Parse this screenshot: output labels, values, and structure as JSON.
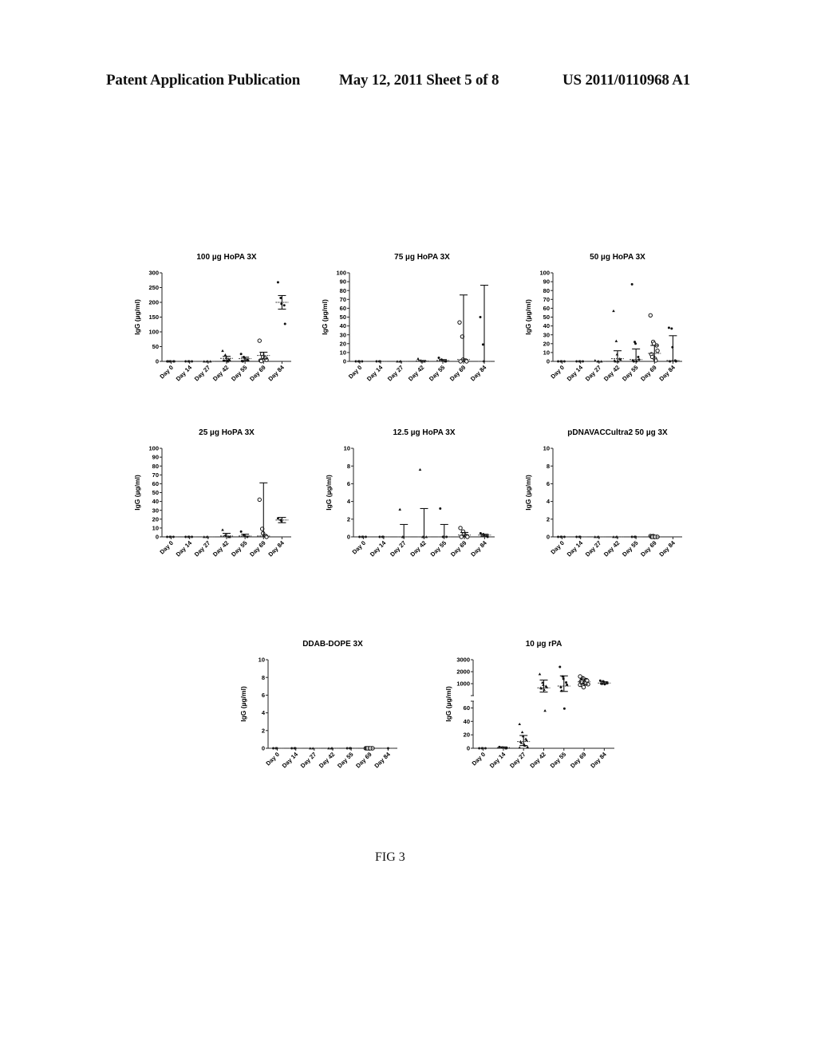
{
  "header": {
    "left": "Patent Application Publication",
    "middle": "May 12, 2011   Sheet 5 of 8",
    "right": "US 2011/0110968 A1"
  },
  "figure_caption": "FIG 3",
  "chart_data": [
    {
      "id": "c100",
      "type": "scatter",
      "title": "100 µg HoPA 3X",
      "xlabel": "",
      "ylabel": "IgG (µg/ml)",
      "categories": [
        "Day 0",
        "Day 14",
        "Day 27",
        "Day 42",
        "Day 55",
        "Day 69",
        "Day 84"
      ],
      "ylim": [
        0,
        300
      ],
      "yticks": [
        0,
        50,
        100,
        150,
        200,
        250,
        300
      ],
      "series": [
        {
          "name": "Day 0",
          "points": [
            0,
            0,
            0,
            0,
            0,
            0
          ],
          "mean": 0,
          "err": [
            0,
            0
          ]
        },
        {
          "name": "Day 14",
          "points": [
            0,
            0,
            0,
            0
          ],
          "mean": 0,
          "err": [
            0,
            0
          ]
        },
        {
          "name": "Day 27",
          "points": [
            0,
            0,
            0,
            0
          ],
          "mean": 0,
          "err": [
            0,
            0
          ]
        },
        {
          "name": "Day 42",
          "points": [
            36,
            22,
            12,
            8,
            5,
            3,
            2,
            1,
            0
          ],
          "mean": 10,
          "err": [
            4,
            17
          ]
        },
        {
          "name": "Day 55",
          "points": [
            25,
            15,
            10,
            6,
            3,
            1,
            0
          ],
          "mean": 9,
          "err": [
            3,
            14
          ]
        },
        {
          "name": "Day 69",
          "points": [
            70,
            25,
            15,
            10,
            5,
            3,
            1
          ],
          "mean": 20,
          "err": [
            8,
            31
          ]
        },
        {
          "name": "Day 84",
          "points": [
            268,
            215,
            195,
            190,
            127
          ],
          "mean": 200,
          "err": [
            177,
            223
          ]
        }
      ]
    },
    {
      "id": "c75",
      "type": "scatter",
      "title": "75 µg HoPA 3X",
      "xlabel": "",
      "ylabel": "IgG (µg/ml)",
      "categories": [
        "Day 0",
        "Day 14",
        "Day 27",
        "Day 42",
        "Day 55",
        "Day 69",
        "Day 84"
      ],
      "ylim": [
        0,
        100
      ],
      "yticks": [
        0,
        10,
        20,
        30,
        40,
        50,
        60,
        70,
        80,
        90,
        100
      ],
      "series": [
        {
          "name": "Day 0",
          "points": [
            0,
            0,
            0,
            0
          ],
          "mean": 0,
          "err": [
            0,
            0
          ]
        },
        {
          "name": "Day 14",
          "points": [
            0,
            0,
            0
          ],
          "mean": 0,
          "err": [
            0,
            0
          ]
        },
        {
          "name": "Day 27",
          "points": [
            0,
            0,
            0
          ],
          "mean": 0,
          "err": [
            0,
            0
          ]
        },
        {
          "name": "Day 42",
          "points": [
            3,
            1,
            0,
            0
          ],
          "mean": 0.5,
          "err": [
            0,
            1
          ]
        },
        {
          "name": "Day 55",
          "points": [
            4,
            2,
            1,
            0,
            0
          ],
          "mean": 1,
          "err": [
            0,
            2
          ]
        },
        {
          "name": "Day 69",
          "points": [
            44,
            28,
            2,
            1,
            0,
            0
          ],
          "mean": 2,
          "err": [
            0,
            75
          ]
        },
        {
          "name": "Day 84",
          "points": [
            50,
            19,
            0
          ],
          "mean": 0,
          "err": [
            0,
            86
          ]
        }
      ]
    },
    {
      "id": "c50",
      "type": "scatter",
      "title": "50 µg HoPA 3X",
      "xlabel": "",
      "ylabel": "IgG (µg/ml)",
      "categories": [
        "Day 0",
        "Day 14",
        "Day 27",
        "Day 42",
        "Day 55",
        "Day 69",
        "Day 84"
      ],
      "ylim": [
        0,
        100
      ],
      "yticks": [
        0,
        10,
        20,
        30,
        40,
        50,
        60,
        70,
        80,
        90,
        100
      ],
      "series": [
        {
          "name": "Day 0",
          "points": [
            0,
            0,
            0,
            0
          ],
          "mean": 0,
          "err": [
            0,
            0
          ]
        },
        {
          "name": "Day 14",
          "points": [
            0,
            0,
            0,
            0
          ],
          "mean": 0,
          "err": [
            0,
            0
          ]
        },
        {
          "name": "Day 27",
          "points": [
            1,
            0,
            0,
            0
          ],
          "mean": 0,
          "err": [
            0,
            0
          ]
        },
        {
          "name": "Day 42",
          "points": [
            57,
            23,
            8,
            3,
            2,
            1,
            0,
            0
          ],
          "mean": 3,
          "err": [
            0,
            12
          ]
        },
        {
          "name": "Day 55",
          "points": [
            87,
            22,
            20,
            5,
            2,
            1,
            0,
            0
          ],
          "mean": 2,
          "err": [
            0,
            14
          ]
        },
        {
          "name": "Day 69",
          "points": [
            52,
            22,
            20,
            18,
            12,
            8,
            5,
            3,
            1
          ],
          "mean": 9,
          "err": [
            0,
            18
          ]
        },
        {
          "name": "Day 84",
          "points": [
            38,
            37,
            16,
            1,
            0,
            0
          ],
          "mean": 1,
          "err": [
            0,
            29
          ]
        }
      ]
    },
    {
      "id": "c25",
      "type": "scatter",
      "title": "25 µg HoPA 3X",
      "xlabel": "",
      "ylabel": "IgG (µg/ml)",
      "categories": [
        "Day 0",
        "Day 14",
        "Day 27",
        "Day 42",
        "Day 55",
        "Day 69",
        "Day 84"
      ],
      "ylim": [
        0,
        100
      ],
      "yticks": [
        0,
        10,
        20,
        30,
        40,
        50,
        60,
        70,
        80,
        90,
        100
      ],
      "series": [
        {
          "name": "Day 0",
          "points": [
            0,
            0,
            0,
            0
          ],
          "mean": 0,
          "err": [
            0,
            0
          ]
        },
        {
          "name": "Day 14",
          "points": [
            0,
            0,
            0,
            0
          ],
          "mean": 0,
          "err": [
            0,
            0
          ]
        },
        {
          "name": "Day 27",
          "points": [
            0,
            0,
            0
          ],
          "mean": 0,
          "err": [
            0,
            0
          ]
        },
        {
          "name": "Day 42",
          "points": [
            8,
            2,
            1,
            0,
            0
          ],
          "mean": 1,
          "err": [
            0,
            4
          ]
        },
        {
          "name": "Day 55",
          "points": [
            6,
            2,
            1,
            0
          ],
          "mean": 1,
          "err": [
            0,
            3
          ]
        },
        {
          "name": "Day 69",
          "points": [
            42,
            9,
            4,
            1,
            0
          ],
          "mean": 1,
          "err": [
            0,
            61
          ]
        },
        {
          "name": "Day 84",
          "points": [
            21,
            19,
            18
          ],
          "mean": 19,
          "err": [
            16,
            22
          ]
        }
      ]
    },
    {
      "id": "c125",
      "type": "scatter",
      "title": "12.5 µg HoPA 3X",
      "xlabel": "",
      "ylabel": "IgG (µg/ml)",
      "categories": [
        "Day 0",
        "Day 14",
        "Day 27",
        "Day 42",
        "Day 55",
        "Day 69",
        "Day 84"
      ],
      "ylim": [
        0,
        10
      ],
      "yticks": [
        0,
        2,
        4,
        6,
        8,
        10
      ],
      "series": [
        {
          "name": "Day 0",
          "points": [
            0,
            0,
            0,
            0
          ],
          "mean": 0,
          "err": [
            0,
            0
          ]
        },
        {
          "name": "Day 14",
          "points": [
            0,
            0,
            0
          ],
          "mean": 0,
          "err": [
            0,
            0
          ]
        },
        {
          "name": "Day 27",
          "points": [
            3.1,
            0,
            0
          ],
          "mean": 0,
          "err": [
            0,
            1.4
          ]
        },
        {
          "name": "Day 42",
          "points": [
            7.6,
            0,
            0,
            0
          ],
          "mean": 0,
          "err": [
            0,
            3.2
          ]
        },
        {
          "name": "Day 55",
          "points": [
            3.2,
            0,
            0,
            0
          ],
          "mean": 0,
          "err": [
            0,
            1.4
          ]
        },
        {
          "name": "Day 69",
          "points": [
            1.0,
            0.6,
            0.3,
            0.1,
            0,
            0
          ],
          "mean": 0.2,
          "err": [
            0,
            0.5
          ]
        },
        {
          "name": "Day 84",
          "points": [
            0.4,
            0.3,
            0.2,
            0.1,
            0
          ],
          "mean": 0.2,
          "err": [
            0.1,
            0.3
          ]
        }
      ]
    },
    {
      "id": "cpdna",
      "type": "scatter",
      "title": "pDNAVACCultra2 50 µg 3X",
      "xlabel": "",
      "ylabel": "IgG (µg/ml)",
      "categories": [
        "Day 0",
        "Day 14",
        "Day 27",
        "Day 42",
        "Day 55",
        "Day 69",
        "Day 84"
      ],
      "ylim": [
        0,
        10
      ],
      "yticks": [
        0,
        2,
        4,
        6,
        8,
        10
      ],
      "series": [
        {
          "name": "Day 0",
          "points": [
            0,
            0,
            0,
            0
          ],
          "mean": 0,
          "err": [
            0,
            0
          ]
        },
        {
          "name": "Day 14",
          "points": [
            0,
            0,
            0
          ],
          "mean": 0,
          "err": [
            0,
            0
          ]
        },
        {
          "name": "Day 27",
          "points": [
            0,
            0,
            0
          ],
          "mean": 0,
          "err": [
            0,
            0
          ]
        },
        {
          "name": "Day 42",
          "points": [
            0,
            0,
            0
          ],
          "mean": 0,
          "err": [
            0,
            0
          ]
        },
        {
          "name": "Day 55",
          "points": [
            0,
            0,
            0
          ],
          "mean": 0,
          "err": [
            0,
            0
          ]
        },
        {
          "name": "Day 69",
          "points": [
            0.1,
            0.1,
            0,
            0,
            0,
            0,
            0,
            0
          ],
          "mean": 0,
          "err": [
            0,
            0
          ]
        },
        {
          "name": "Day 84",
          "points": [],
          "mean": null,
          "err": [
            0,
            0
          ]
        }
      ]
    },
    {
      "id": "cddab",
      "type": "scatter",
      "title": "DDAB-DOPE 3X",
      "xlabel": "",
      "ylabel": "IgG (µg/ml)",
      "categories": [
        "Day 0",
        "Day 14",
        "Day 27",
        "Day 42",
        "Day 55",
        "Day 69",
        "Day 84"
      ],
      "ylim": [
        0,
        10
      ],
      "yticks": [
        0,
        2,
        4,
        6,
        8,
        10
      ],
      "series": [
        {
          "name": "Day 0",
          "points": [
            0,
            0,
            0
          ],
          "mean": 0,
          "err": [
            0,
            0
          ]
        },
        {
          "name": "Day 14",
          "points": [
            0,
            0,
            0
          ],
          "mean": 0,
          "err": [
            0,
            0
          ]
        },
        {
          "name": "Day 27",
          "points": [
            0,
            0
          ],
          "mean": 0,
          "err": [
            0,
            0
          ]
        },
        {
          "name": "Day 42",
          "points": [
            0,
            0,
            0
          ],
          "mean": 0,
          "err": [
            0,
            0
          ]
        },
        {
          "name": "Day 55",
          "points": [
            0,
            0,
            0
          ],
          "mean": 0,
          "err": [
            0,
            0
          ]
        },
        {
          "name": "Day 69",
          "points": [
            0,
            0,
            0,
            0,
            0,
            0,
            0,
            0
          ],
          "mean": 0,
          "err": [
            0,
            0
          ]
        },
        {
          "name": "Day 84",
          "points": [
            0
          ],
          "mean": 0,
          "err": [
            0,
            0
          ]
        }
      ]
    },
    {
      "id": "crpa",
      "type": "scatter",
      "title": "10 µg rPA",
      "xlabel": "",
      "ylabel": "IgG (µg/ml)",
      "categories": [
        "Day 0",
        "Day 14",
        "Day 27",
        "Day 42",
        "Day 55",
        "Day 69",
        "Day 84"
      ],
      "broken_axis": {
        "lower": [
          0,
          70
        ],
        "upper": [
          0,
          3000
        ]
      },
      "yticks_lower": [
        0,
        20,
        40,
        60
      ],
      "yticks_upper": [
        1000,
        2000,
        3000
      ],
      "series": [
        {
          "name": "Day 0",
          "points": [
            0,
            0,
            0,
            0
          ],
          "mean": 0,
          "err": [
            0,
            0
          ]
        },
        {
          "name": "Day 14",
          "points": [
            2,
            1,
            1,
            0,
            0
          ],
          "mean": 1,
          "err": [
            0,
            2
          ]
        },
        {
          "name": "Day 27",
          "points": [
            36,
            24,
            18,
            14,
            12,
            10,
            8,
            6,
            4,
            2,
            1
          ],
          "mean": 10,
          "err": [
            4,
            19
          ]
        },
        {
          "name": "Day 42",
          "points": [
            1800,
            1100,
            900,
            800,
            700,
            650,
            600,
            500,
            56
          ],
          "mean": 650,
          "err": [
            300,
            1300
          ]
        },
        {
          "name": "Day 55",
          "points": [
            2400,
            1600,
            1400,
            1100,
            900,
            700,
            400,
            59
          ],
          "mean": 800,
          "err": [
            350,
            1650
          ]
        },
        {
          "name": "Day 69",
          "points": [
            1600,
            1450,
            1400,
            1300,
            1250,
            1200,
            1150,
            1100,
            1000,
            950,
            900,
            850,
            700
          ],
          "mean": 1150,
          "err": [
            950,
            1400
          ]
        },
        {
          "name": "Day 84",
          "points": [
            1250,
            1200,
            1150,
            1100,
            1050,
            1000,
            980,
            950
          ],
          "mean": 1050,
          "err": [
            980,
            1150
          ]
        }
      ]
    }
  ]
}
